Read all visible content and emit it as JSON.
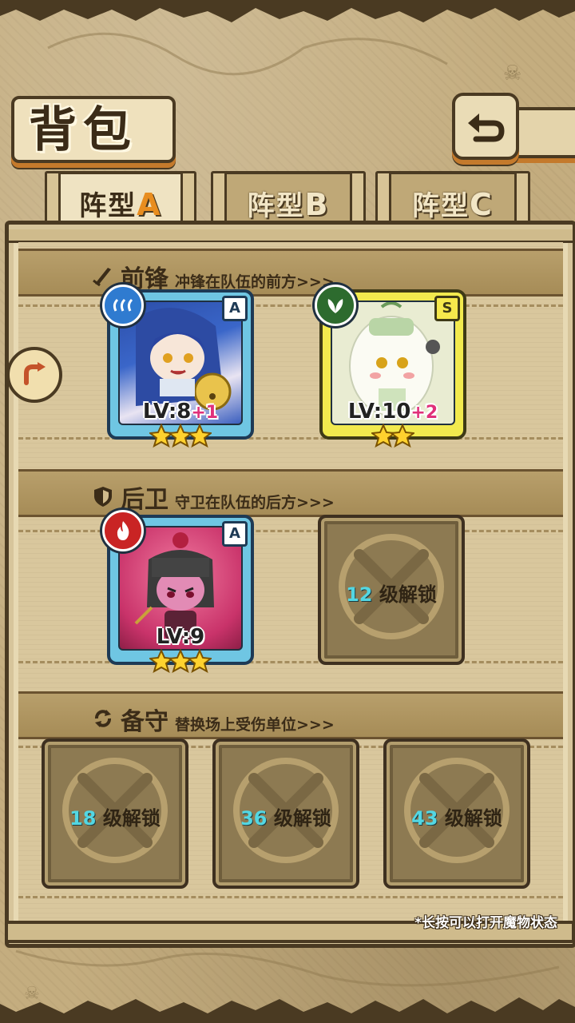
{
  "header": {
    "title": "背包",
    "back_icon": "back-arrow-icon"
  },
  "tabs": [
    {
      "prefix": "阵型",
      "letter": "A",
      "active": true
    },
    {
      "prefix": "阵型",
      "letter": "B",
      "active": false
    },
    {
      "prefix": "阵型",
      "letter": "C",
      "active": false
    }
  ],
  "sections": {
    "front": {
      "title": "前锋",
      "subtitle": "冲锋在队伍的前方>>>",
      "icon": "sword-icon"
    },
    "rear": {
      "title": "后卫",
      "subtitle": "守卫在队伍的后方>>>",
      "icon": "shield-icon"
    },
    "reserve": {
      "title": "备守",
      "subtitle": "替换场上受伤单位>>>",
      "icon": "swap-icon"
    }
  },
  "front_units": [
    {
      "element": "water",
      "rank": "A",
      "level": "LV:8",
      "bonus": "+1",
      "stars": 3,
      "frame": "blue"
    },
    {
      "element": "nature",
      "rank": "S",
      "level": "LV:10",
      "bonus": "+2",
      "stars": 2,
      "frame": "yellow"
    }
  ],
  "rear_units": [
    {
      "element": "fire",
      "rank": "A",
      "level": "LV:9",
      "bonus": "",
      "stars": 3,
      "frame": "blue"
    }
  ],
  "locked_slots": {
    "rear": {
      "level": "12",
      "text": "级解锁"
    },
    "reserve": [
      {
        "level": "18",
        "text": "级解锁"
      },
      {
        "level": "36",
        "text": "级解锁"
      },
      {
        "level": "43",
        "text": "级解锁"
      }
    ]
  },
  "hint": "*长按可以打开魔物状态",
  "colors": {
    "accent_orange": "#e88d1f",
    "unlock_cyan": "#53d7e3",
    "bonus_pink": "#e0307a",
    "frame_blue": "#6fc6e3",
    "frame_yellow": "#f2ea4e"
  }
}
